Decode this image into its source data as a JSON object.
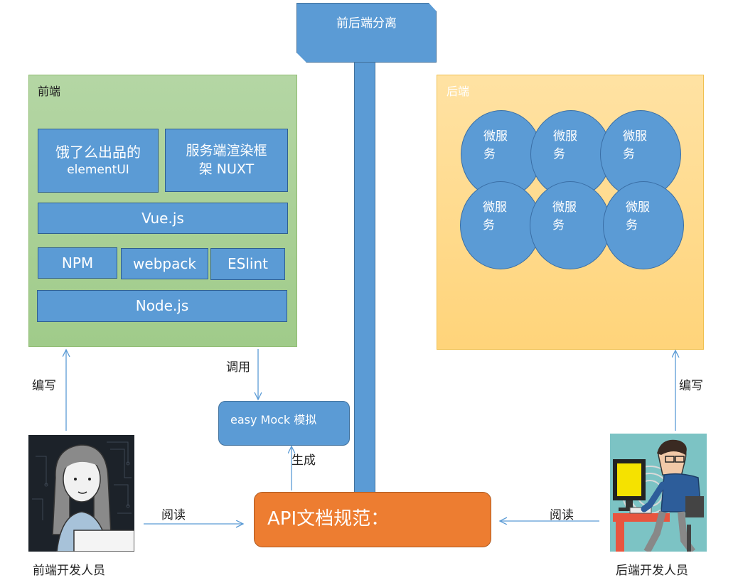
{
  "title": "前后端分离",
  "frontend": {
    "label": "前端",
    "blocks": {
      "element_ui": [
        "饿了么出品的",
        "elementUI"
      ],
      "nuxt": [
        "服务端渲染框",
        "架 NUXT"
      ],
      "vue": "Vue.js",
      "npm": "NPM",
      "webpack": "webpack",
      "eslint": "ESlint",
      "node": "Node.js"
    }
  },
  "backend": {
    "label": "后端",
    "services": [
      [
        "微服",
        "务"
      ],
      [
        "微服",
        "务"
      ],
      [
        "微服",
        "务"
      ],
      [
        "微服",
        "务"
      ],
      [
        "微服",
        "务"
      ],
      [
        "微服",
        "务"
      ]
    ]
  },
  "mock": "easy Mock  模拟",
  "api": "API文档规范：",
  "labels": {
    "call": "调用",
    "generate": "生成",
    "write_front": "编写",
    "write_back": "编写",
    "read_front": "阅读",
    "read_back": "阅读"
  },
  "people": {
    "frontend_dev": "前端开发人员",
    "backend_dev": "后端开发人员"
  },
  "colors": {
    "blue": "#5b9bd5",
    "orange": "#ed7d31",
    "green": "#a9d18e",
    "yellow": "#ffd97a"
  }
}
